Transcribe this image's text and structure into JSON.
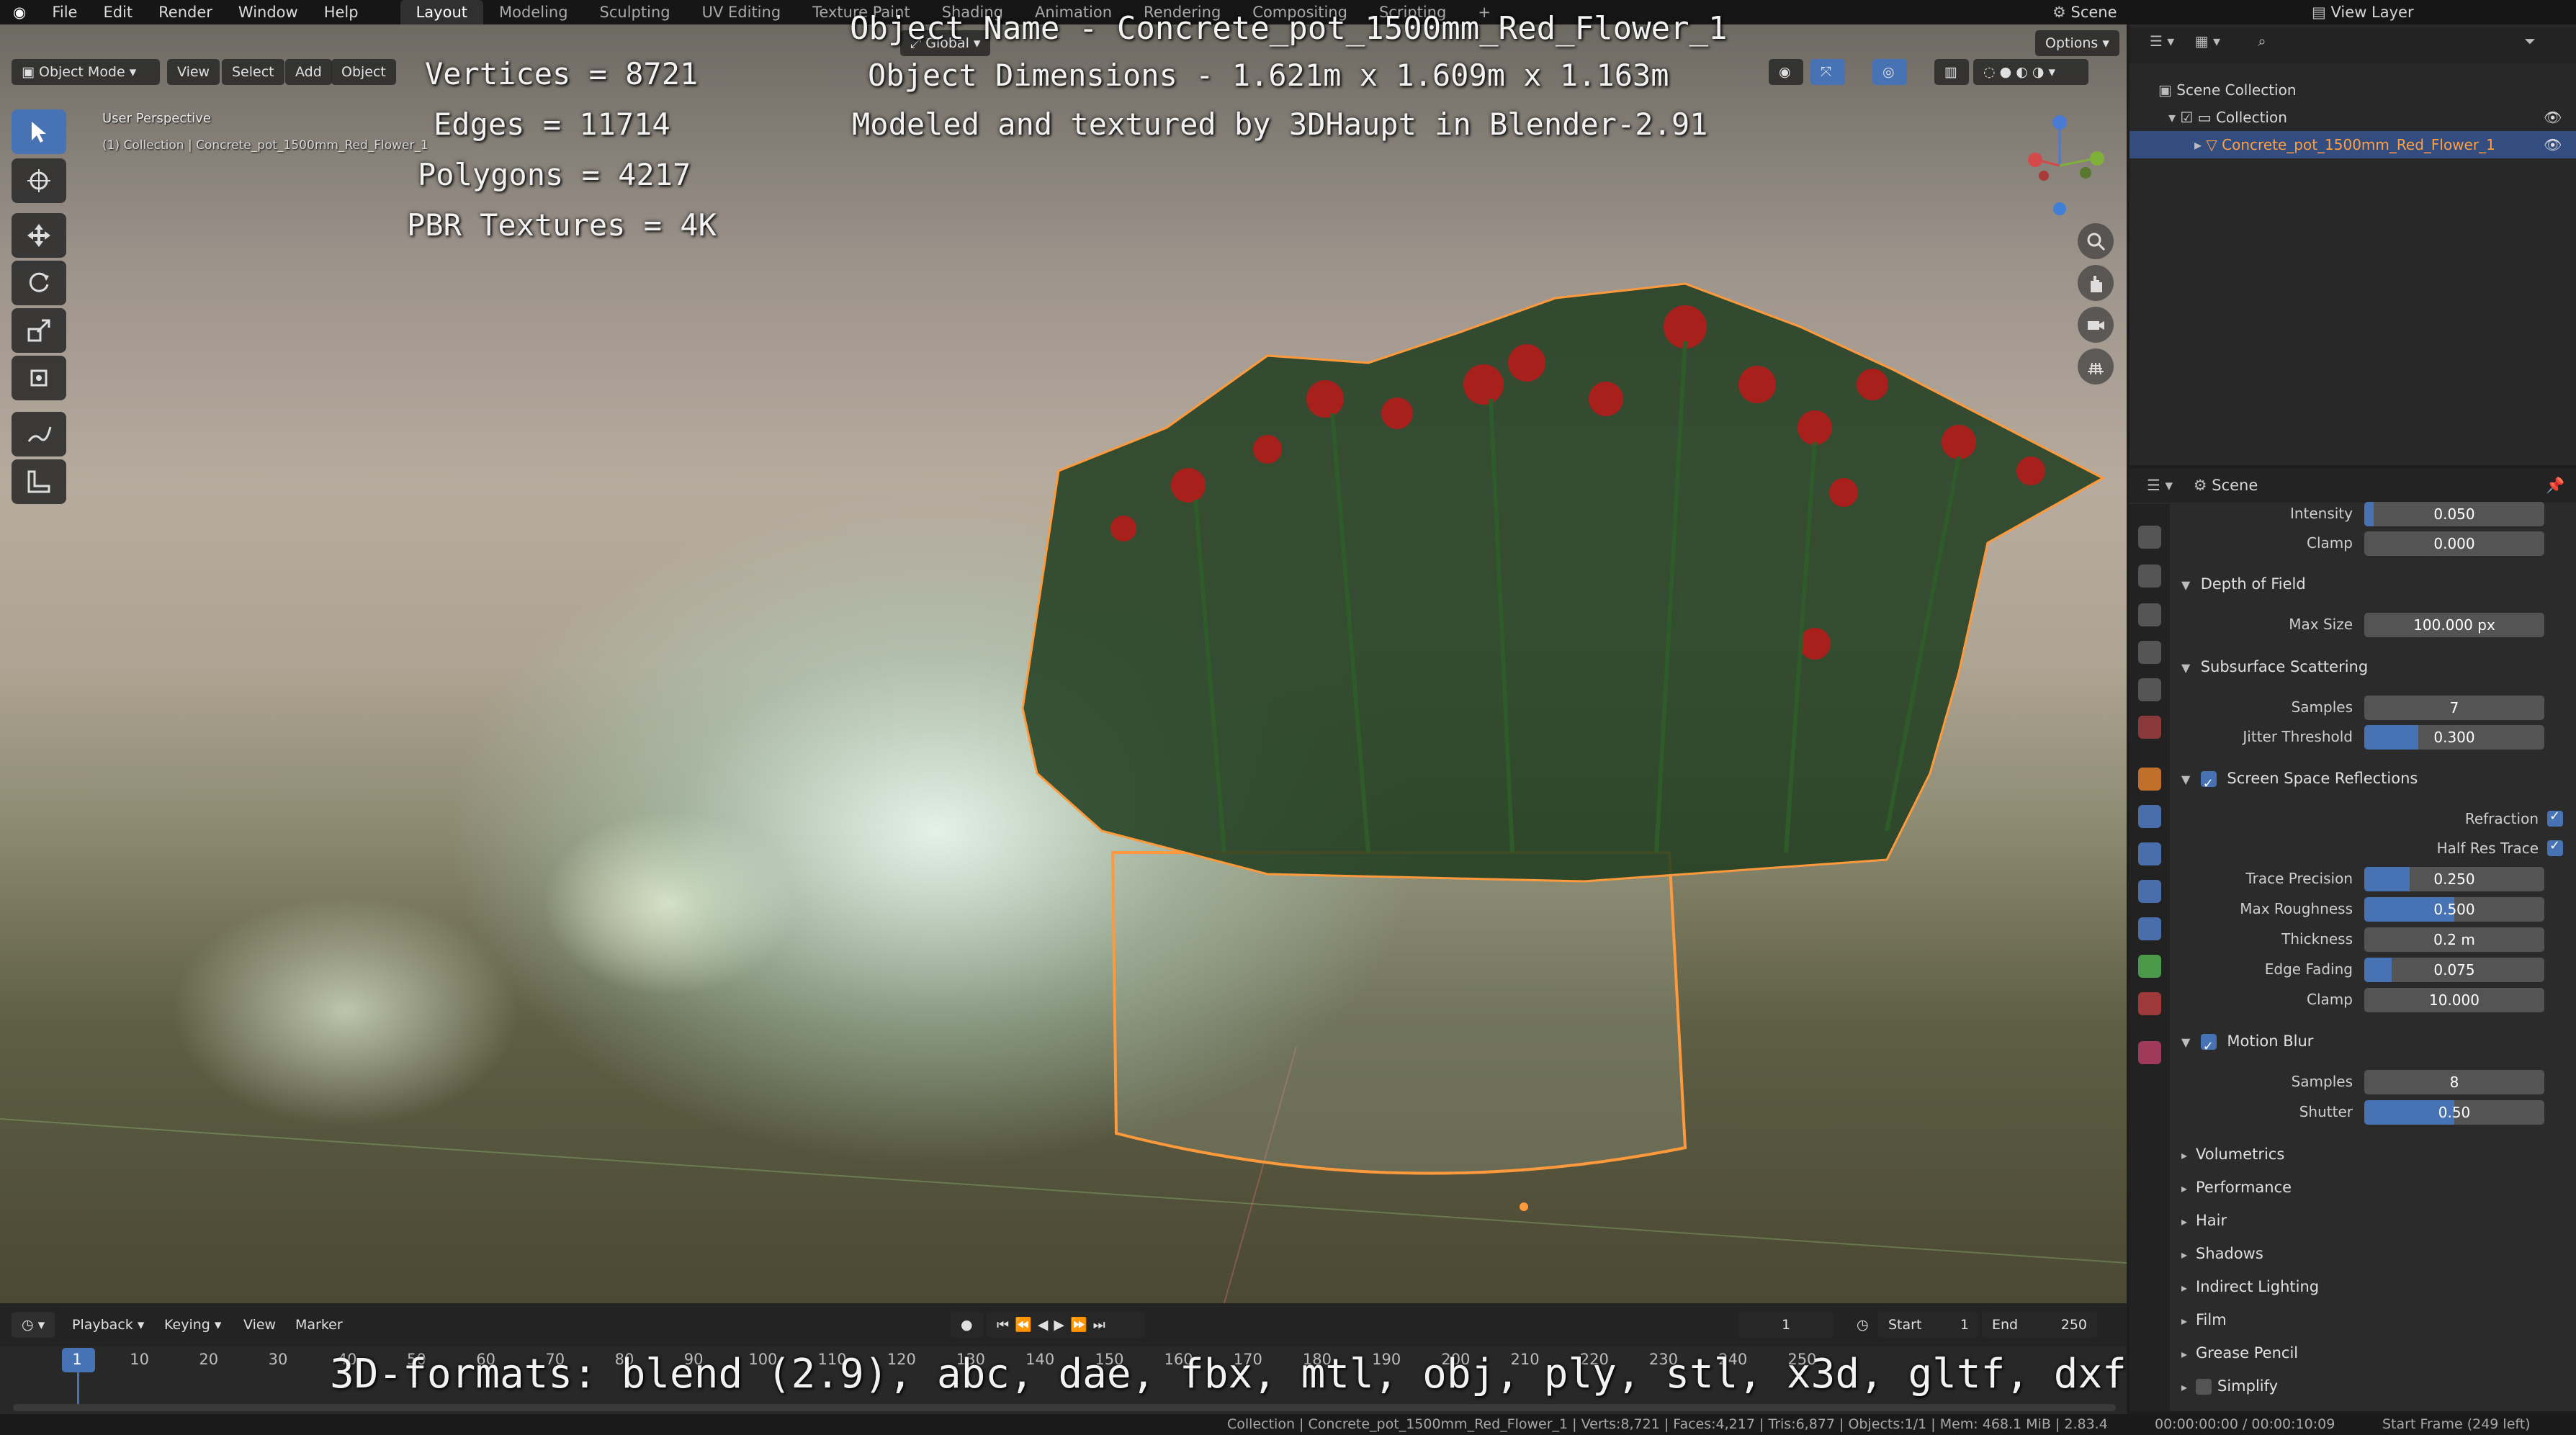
{
  "topbar": {
    "menus": [
      "File",
      "Edit",
      "Render",
      "Window",
      "Help"
    ],
    "workspaces": [
      "Layout",
      "Modeling",
      "Sculpting",
      "UV Editing",
      "Texture Paint",
      "Shading",
      "Animation",
      "Rendering",
      "Compositing",
      "Scripting"
    ],
    "active_workspace": "Layout",
    "add_workspace": "+",
    "scene_label": "Scene",
    "view_layer_label": "View Layer"
  },
  "viewport": {
    "mode": "Object Mode",
    "menus": [
      "View",
      "Select",
      "Add",
      "Object"
    ],
    "orientation": "Global",
    "options": "Options",
    "perspective_label": "User Perspective",
    "collection_label": "(1) Collection | Concrete_pot_1500mm_Red_Flower_1"
  },
  "overlay": {
    "stats": [
      "Vertices = 8721",
      "Edges = 11714",
      "Polygons = 4217",
      "PBR Textures = 4K"
    ],
    "object_name": "Object Name - Concrete_pot_1500mm_Red_Flower_1",
    "dimensions": "Object Dimensions -  1.621m x 1.609m x 1.163m",
    "credit": "Modeled and textured by 3DHaupt in Blender-2.91",
    "formats": "3D-formats: blend (2.9), abc, dae, fbx, mtl, obj, ply, stl, x3d, gltf, dxf"
  },
  "outliner": {
    "root": "Scene Collection",
    "collection": "Collection",
    "object": "Concrete_pot_1500mm_Red_Flower_1"
  },
  "properties": {
    "context": "Scene",
    "rows": {
      "intensity": {
        "label": "Intensity",
        "value": "0.050",
        "fill": 0.05
      },
      "clamp_top": {
        "label": "Clamp",
        "value": "0.000",
        "fill": 0.0
      },
      "dof_header": "Depth of Field",
      "max_size": {
        "label": "Max Size",
        "value": "100.000 px",
        "fill": 0.0
      },
      "sss_header": "Subsurface Scattering",
      "samples_sss": {
        "label": "Samples",
        "value": "7",
        "fill": 0.0
      },
      "jitter": {
        "label": "Jitter Threshold",
        "value": "0.300",
        "fill": 0.3
      },
      "ssr_header": "Screen Space Reflections",
      "refraction": "Refraction",
      "half_res": "Half Res Trace",
      "trace_precision": {
        "label": "Trace Precision",
        "value": "0.250",
        "fill": 0.25
      },
      "max_roughness": {
        "label": "Max Roughness",
        "value": "0.500",
        "fill": 0.5
      },
      "thickness": {
        "label": "Thickness",
        "value": "0.2 m",
        "fill": 0.0
      },
      "edge_fading": {
        "label": "Edge Fading",
        "value": "0.075",
        "fill": 0.15
      },
      "clamp_ssr": {
        "label": "Clamp",
        "value": "10.000",
        "fill": 0.0
      },
      "mb_header": "Motion Blur",
      "samples_mb": {
        "label": "Samples",
        "value": "8",
        "fill": 0.0
      },
      "shutter": {
        "label": "Shutter",
        "value": "0.50",
        "fill": 0.5
      }
    },
    "collapsed": [
      "Volumetrics",
      "Performance",
      "Hair",
      "Shadows",
      "Indirect Lighting",
      "Film",
      "Grease Pencil",
      "Simplify"
    ]
  },
  "timeline": {
    "menus": [
      "Playback",
      "Keying",
      "View",
      "Marker"
    ],
    "current_frame": "1",
    "start_label": "Start",
    "start": "1",
    "end_label": "End",
    "end": "250",
    "ticks": [
      "1",
      "10",
      "20",
      "30",
      "40",
      "50",
      "60",
      "70",
      "80",
      "90",
      "100",
      "110",
      "120",
      "130",
      "140",
      "150",
      "160",
      "170",
      "180",
      "190",
      "200",
      "210",
      "220",
      "230",
      "240",
      "250"
    ]
  },
  "statusbar": {
    "stats": "Collection | Concrete_pot_1500mm_Red_Flower_1 | Verts:8,721 | Faces:4,217 | Tris:6,877 | Objects:1/1 | Mem: 468.1 MiB | 2.83.4",
    "time": "00:00:00:00 / 00:00:10:09",
    "frame_info": "Start Frame (249 left)"
  },
  "colors": {
    "accent": "#4772b3",
    "selection_outline": "#ff9a3c",
    "active_object_text": "#ffa040"
  }
}
